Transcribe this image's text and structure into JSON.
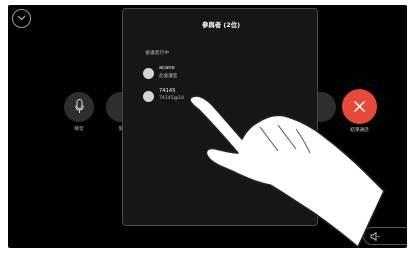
{
  "controls": {
    "mute_label": "靜音",
    "second_label": "開",
    "end_call_label": "結束通話"
  },
  "participants_panel": {
    "title": "參與者 (2位)",
    "section_label": "會議進行中",
    "participants": [
      {
        "name": "acano",
        "status": "此會議室"
      },
      {
        "name": "74145",
        "status": "74145@10"
      }
    ]
  },
  "colors": {
    "end_call": "#e64a3b",
    "background": "#000000",
    "panel": "#161616"
  },
  "icons": [
    "chevron-down-icon",
    "microphone-icon",
    "close-icon",
    "volume-down-icon",
    "volume-up-icon",
    "hand-pointer-icon"
  ]
}
